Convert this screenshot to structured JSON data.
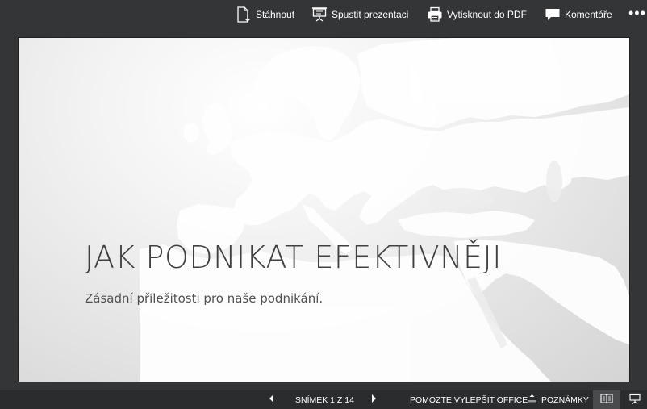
{
  "toolbar": {
    "download": {
      "label": "Stáhnout",
      "icon": "download-document-icon"
    },
    "present": {
      "label": "Spustit prezentaci",
      "icon": "presentation-screen-icon"
    },
    "print": {
      "label": "Vytisknout do PDF",
      "icon": "printer-icon"
    },
    "comments": {
      "label": "Komentáře",
      "icon": "comment-bubble-icon"
    },
    "more": {
      "label": "•••",
      "icon": "more-options-icon"
    }
  },
  "slide": {
    "title": "JAK PODNIKAT EFEKTIVNĚJI",
    "subtitle": "Zásadní příležitosti pro naše podnikání.",
    "background_image": "world-map-europe"
  },
  "statusbar": {
    "prev_icon": "triangle-left-icon",
    "counter": "SNÍMEK 1 Z 14",
    "next_icon": "triangle-right-icon",
    "feedback": "POMOZTE VYLEPŠIT OFFICE",
    "notes": {
      "label": "POZNÁMKY",
      "icon": "notes-lines-icon"
    },
    "reading_view_icon": "open-book-icon",
    "slideshow_icon": "presentation-screen-icon"
  },
  "colors": {
    "chrome_background": "#343537",
    "statusbar_background": "#2b2c2e",
    "slide_title": "#404040",
    "map_land": "#ffffff"
  }
}
